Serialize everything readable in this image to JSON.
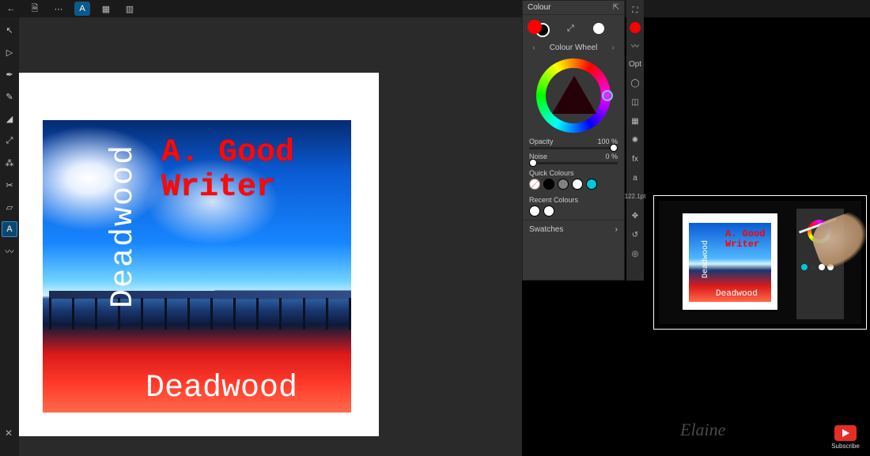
{
  "topbar": {
    "back": "←",
    "doc": "🗎",
    "more": "⋯",
    "app": "A",
    "grid": "▦",
    "snap": "▥"
  },
  "tools": [
    {
      "name": "move",
      "glyph": "↖",
      "active": false
    },
    {
      "name": "node",
      "glyph": "▷",
      "active": false
    },
    {
      "name": "pen",
      "glyph": "✒",
      "active": false
    },
    {
      "name": "pencil",
      "glyph": "✎",
      "active": false
    },
    {
      "name": "fill",
      "glyph": "◢",
      "active": false
    },
    {
      "name": "eyedropper",
      "glyph": "⤢",
      "active": false
    },
    {
      "name": "brush",
      "glyph": "⁂",
      "active": false
    },
    {
      "name": "crop",
      "glyph": "✂",
      "active": false
    },
    {
      "name": "frame",
      "glyph": "▱",
      "active": false
    },
    {
      "name": "art-text",
      "glyph": "A",
      "active": true
    },
    {
      "name": "vector-brush",
      "glyph": "〰",
      "active": false
    }
  ],
  "canvas": {
    "author_text": "A. Good Writer",
    "title_vertical": "Deadwood",
    "title_bottom": "Deadwood"
  },
  "panel": {
    "title": "Colour",
    "mode": "Colour Wheel",
    "opacity_label": "Opacity",
    "opacity_value": "100 %",
    "noise_label": "Noise",
    "noise_value": "0 %",
    "quick_label": "Quick Colours",
    "quick_colours": [
      "#ffffff00",
      "#000000",
      "#808080",
      "#ffffff",
      "#00c8d7"
    ],
    "quick_stroke_first": true,
    "recent_label": "Recent Colours",
    "recent_colours": [
      "#ffffff",
      "#ffffff"
    ],
    "swatches_label": "Swatches",
    "fill_colour": "#ff0000",
    "stroke_colour": "#000000"
  },
  "studio": {
    "items": [
      {
        "name": "expand",
        "glyph": "⛶"
      },
      {
        "name": "colour",
        "glyph": "●",
        "red": true
      },
      {
        "name": "brush",
        "glyph": "〰"
      },
      {
        "name": "opt",
        "glyph": "Opt"
      },
      {
        "name": "stroke",
        "glyph": "◯"
      },
      {
        "name": "layers",
        "glyph": "◫"
      },
      {
        "name": "grid",
        "glyph": "▦"
      },
      {
        "name": "adjust",
        "glyph": "✺"
      },
      {
        "name": "fx",
        "glyph": "fx"
      },
      {
        "name": "text",
        "glyph": "a"
      },
      {
        "name": "fontsize",
        "glyph": "122.1pt",
        "small": true
      },
      {
        "name": "transform",
        "glyph": "✥"
      },
      {
        "name": "history",
        "glyph": "↺"
      },
      {
        "name": "nav",
        "glyph": "◎"
      }
    ]
  },
  "pip": {
    "author_text": "A. Good\nWriter",
    "title_vertical": "Deadwood",
    "title_bottom": "Deadwood"
  },
  "subscribe": {
    "label": "Subscribe"
  },
  "signature": "Elaine",
  "status": {
    "close": "✕"
  }
}
